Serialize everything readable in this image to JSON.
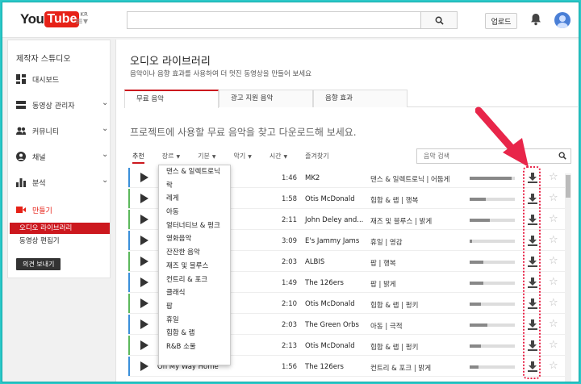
{
  "header": {
    "logo_you": "You",
    "logo_tube": "Tube",
    "logo_region": "KR",
    "upload_label": "업로드"
  },
  "sidebar": {
    "title": "제작자 스튜디오",
    "items": [
      {
        "label": "대시보드",
        "icon": "dashboard-icon"
      },
      {
        "label": "동영상 관리자",
        "icon": "video-manager-icon"
      },
      {
        "label": "커뮤니티",
        "icon": "community-icon"
      },
      {
        "label": "채널",
        "icon": "channel-icon"
      },
      {
        "label": "분석",
        "icon": "analytics-icon"
      },
      {
        "label": "만들기",
        "icon": "create-icon"
      }
    ],
    "subitems": [
      "오디오 라이브러리",
      "동영상 편집기"
    ],
    "feedback_label": "의견 보내기"
  },
  "main": {
    "title": "오디오 라이브러리",
    "subtitle": "음악이나 음향 효과를 사용하여 더 멋진 동영상을 만들어 보세요",
    "tabs": [
      "무료 음악",
      "광고 지원 음악",
      "음향 효과"
    ],
    "lead": "프로젝트에 사용할 무료 음악을 찾고 다운로드해 보세요.",
    "filters": [
      "추천",
      "장르",
      "기분",
      "악기",
      "시간",
      "즐겨찾기"
    ],
    "search_placeholder": "음악 검색",
    "accent": "#cc181e"
  },
  "genre_dropdown": [
    "댄스 & 일렉트로닉",
    "락",
    "레게",
    "아동",
    "얼터너티브 & 펑크",
    "영화음악",
    "잔잔한 음악",
    "재즈 및 블루스",
    "컨트리 & 포크",
    "클래식",
    "팝",
    "휴일",
    "힙합 & 랩",
    "R&B 소울"
  ],
  "tracks": [
    {
      "title": "",
      "time": "1:46",
      "artist": "MK2",
      "genre": "댄스 & 일렉트로닉 | 어둡게",
      "color": "#3b8fd9",
      "pop": 0.92
    },
    {
      "title": "",
      "time": "1:58",
      "artist": "Otis McDonald",
      "genre": "힙합 & 랩 | 행복",
      "color": "#5cb85c",
      "pop": 0.35
    },
    {
      "title": "",
      "time": "2:11",
      "artist": "John Deley and...",
      "genre": "재즈 및 블루스 | 밝게",
      "color": "#5cb85c",
      "pop": 0.45
    },
    {
      "title": "",
      "time": "3:09",
      "artist": "E's Jammy Jams",
      "genre": "휴일 | 영감",
      "color": "#3b8fd9",
      "pop": 0.05
    },
    {
      "title": "",
      "time": "2:03",
      "artist": "ALBIS",
      "genre": "팝 | 행복",
      "color": "#5cb85c",
      "pop": 0.3
    },
    {
      "title": "",
      "time": "1:49",
      "artist": "The 126ers",
      "genre": "팝 | 밝게",
      "color": "#3b8fd9",
      "pop": 0.3
    },
    {
      "title": "",
      "time": "2:10",
      "artist": "Otis McDonald",
      "genre": "힙합 & 랩 | 펑키",
      "color": "#5cb85c",
      "pop": 0.25
    },
    {
      "title": "",
      "time": "2:03",
      "artist": "The Green Orbs",
      "genre": "아동 | 극적",
      "color": "#3b8fd9",
      "pop": 0.4
    },
    {
      "title": "",
      "time": "2:13",
      "artist": "Otis McDonald",
      "genre": "힙합 & 랩 | 펑키",
      "color": "#5cb85c",
      "pop": 0.25
    },
    {
      "title": "On My Way Home",
      "time": "1:56",
      "artist": "The 126ers",
      "genre": "컨트리 & 포크 | 밝게",
      "color": "#3b8fd9",
      "pop": 0.2
    }
  ]
}
